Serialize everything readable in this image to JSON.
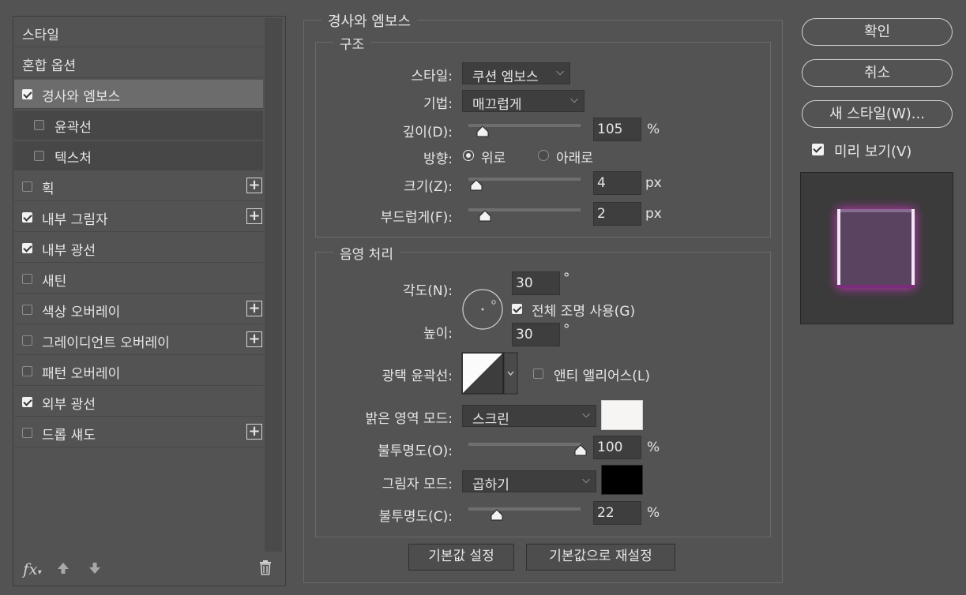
{
  "effects_list": {
    "items": [
      {
        "label": "스타일",
        "type": "header"
      },
      {
        "label": "혼합 옵션",
        "type": "header"
      },
      {
        "label": "경사와 엠보스",
        "checked": true,
        "selected": true
      },
      {
        "label": "윤곽선",
        "checked": false,
        "sub": true
      },
      {
        "label": "텍스처",
        "checked": false,
        "sub": true
      },
      {
        "label": "획",
        "checked": false,
        "plus": true
      },
      {
        "label": "내부 그림자",
        "checked": true,
        "plus": true
      },
      {
        "label": "내부 광선",
        "checked": true
      },
      {
        "label": "새틴",
        "checked": false
      },
      {
        "label": "색상 오버레이",
        "checked": false,
        "plus": true
      },
      {
        "label": "그레이디언트 오버레이",
        "checked": false,
        "plus": true
      },
      {
        "label": "패턴 오버레이",
        "checked": false
      },
      {
        "label": "외부 광선",
        "checked": true
      },
      {
        "label": "드롭 섀도",
        "checked": false,
        "plus": true
      }
    ],
    "footer": {
      "fx": "fx",
      "up_icon": "arrow-up-icon",
      "down_icon": "arrow-down-icon",
      "trash_icon": "trash-icon"
    }
  },
  "bevel": {
    "title": "경사와 엠보스",
    "structure": {
      "legend": "구조",
      "style_label": "스타일:",
      "style_value": "쿠션 엠보스",
      "technique_label": "기법:",
      "technique_value": "매끄럽게",
      "depth_label": "깊이(D):",
      "depth_value": "105",
      "depth_unit": "%",
      "depth_fraction": 0.09,
      "direction_label": "방향:",
      "dir_up": "위로",
      "dir_down": "아래로",
      "direction": "up",
      "size_label": "크기(Z):",
      "size_value": "4",
      "size_unit": "px",
      "size_fraction": 0.03,
      "soften_label": "부드럽게(F):",
      "soften_value": "2",
      "soften_unit": "px",
      "soften_fraction": 0.11
    },
    "shading": {
      "legend": "음영 처리",
      "angle_label": "각도(N):",
      "angle_value": "30",
      "degree": "°",
      "global_light_label": "전체 조명 사용(G)",
      "global_light": true,
      "altitude_label": "높이:",
      "altitude_value": "30",
      "gloss_label": "광택 윤곽선:",
      "antialias_label": "앤티 앨리어스(L)",
      "antialias": false,
      "highlight_label": "밝은 영역 모드:",
      "highlight_mode": "스크린",
      "highlight_color": "#f7f4f4",
      "hl_opacity_label": "불투명도(O):",
      "hl_opacity_value": "100",
      "hl_opacity_unit": "%",
      "hl_opacity_fraction": 1.0,
      "shadow_label": "그림자 모드:",
      "shadow_mode": "곱하기",
      "shadow_color": "#000000",
      "sh_opacity_label": "불투명도(C):",
      "sh_opacity_value": "22",
      "sh_opacity_unit": "%",
      "sh_opacity_fraction": 0.22
    },
    "buttons": {
      "make_default": "기본값 설정",
      "reset_default": "기본값으로 재설정"
    }
  },
  "right": {
    "ok": "확인",
    "cancel": "취소",
    "new_style": "새 스타일(W)...",
    "preview_label": "미리 보기(V)",
    "preview_checked": true
  }
}
